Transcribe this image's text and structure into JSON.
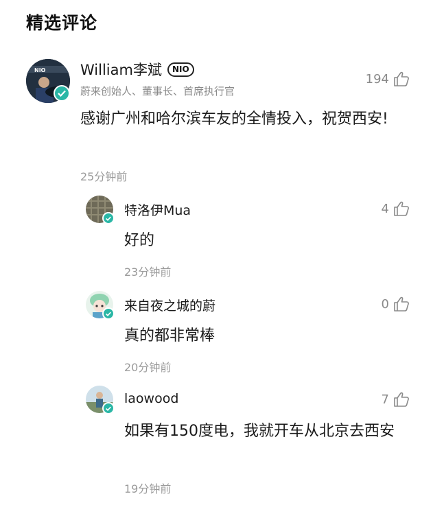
{
  "section_title": "精选评论",
  "main_comment": {
    "author": "William李斌",
    "badge": "NIO",
    "author_subtitle": "蔚来创始人、董事长、首席执行官",
    "likes": "194",
    "text": "感谢广州和哈尔滨车友的全情投入，祝贺西安!",
    "time": "25分钟前"
  },
  "replies": [
    {
      "author": "特洛伊Mua",
      "likes": "4",
      "text": "好的",
      "time": "23分钟前"
    },
    {
      "author": "来自夜之城的蔚",
      "likes": "0",
      "text": "真的都非常棒",
      "time": "20分钟前"
    },
    {
      "author": "laowood",
      "likes": "7",
      "text": "如果有150度电，我就开车从北京去西安",
      "time": "19分钟前"
    }
  ],
  "colors": {
    "verified_badge": "#2bb7a6",
    "secondary_text": "#8a8a8a"
  },
  "icons": {
    "like": "thumbs-up-icon",
    "verified": "verified-check-icon"
  }
}
